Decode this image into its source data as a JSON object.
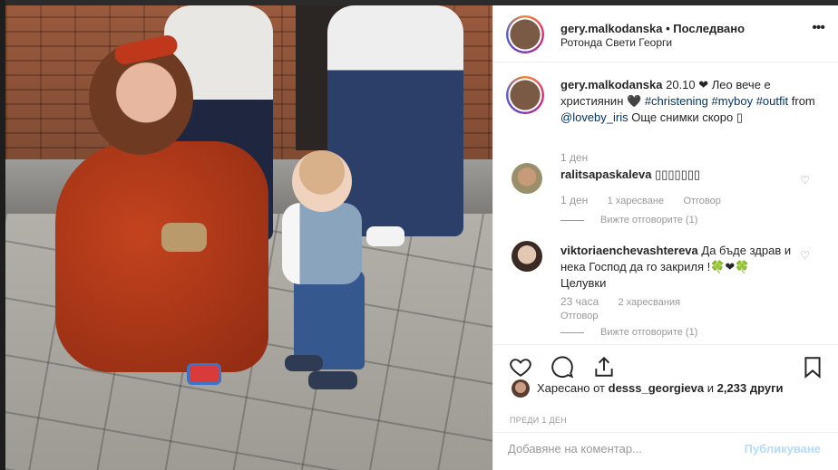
{
  "header": {
    "username": "gery.malkodanska",
    "separator": "•",
    "follow_state": "Последвано",
    "location": "Ротонда Свети Георги",
    "more_icon": "more-dots-icon"
  },
  "caption": {
    "username": "gery.malkodanska",
    "text_1": "20.10 ❤ Лео вече е християнин",
    "heart_emoji": "🖤",
    "tag_1": "#christening",
    "tag_2": "#myboy",
    "tag_3": "#outfit",
    "from": "from",
    "mention": "@loveby_iris",
    "text_2": "Още снимки скоро",
    "box": "▯",
    "time": "1 ден"
  },
  "comments": [
    {
      "username": "ralitsapaskaleva",
      "text": "▯▯▯▯▯▯▯",
      "time": "1 ден",
      "likes": "1 харесване",
      "reply": "Отговор",
      "replies": "Вижте отговорите (1)"
    },
    {
      "username": "viktoriaenchevashtereva",
      "text": "Да бъде здрав и нека Господ да го закриля !🍀❤🍀 Целувки",
      "time": "23 часа",
      "likes": "2 харесвания",
      "reply": "Отговор",
      "replies": "Вижте отговорите (1)"
    }
  ],
  "actions": {
    "like_icon": "heart-icon",
    "comment_icon": "comment-icon",
    "share_icon": "share-icon",
    "save_icon": "bookmark-icon"
  },
  "likes": {
    "prefix": "Харесано от",
    "user": "desss_georgieva",
    "and": "и",
    "count": "2,233 други"
  },
  "post_time": "ПРЕДИ 1 ДЕН",
  "add_comment": {
    "placeholder": "Добавяне на коментар...",
    "publish": "Публикуване"
  }
}
